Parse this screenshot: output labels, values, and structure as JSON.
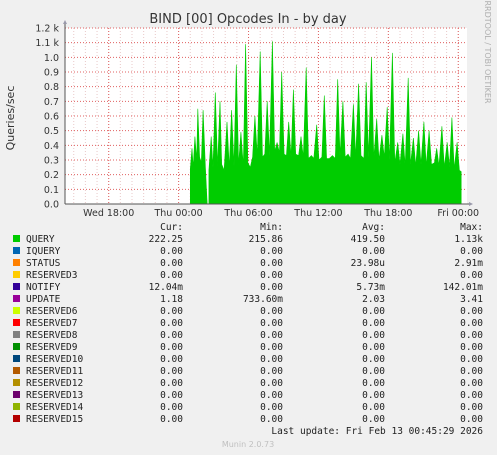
{
  "title": "BIND [00] Opcodes In - by day",
  "side_label": "RRDTOOL / TOBI OETIKER",
  "footer": "Munin 2.0.73",
  "last_update": "Last update: Fri Feb 13 00:45:29 2026",
  "table_headers": {
    "cur": "Cur:",
    "min": "Min:",
    "avg": "Avg:",
    "max": "Max:"
  },
  "chart_data": {
    "type": "area",
    "title": "BIND [00] Opcodes In - by day",
    "ylabel": "Queries/sec",
    "xlabel": "",
    "grid": true,
    "ylim": [
      0,
      1200
    ],
    "y_ticks": [
      {
        "v": 0,
        "label": "0.0"
      },
      {
        "v": 100,
        "label": "0.1"
      },
      {
        "v": 200,
        "label": "0.2"
      },
      {
        "v": 300,
        "label": "0.3"
      },
      {
        "v": 400,
        "label": "0.4"
      },
      {
        "v": 500,
        "label": "0.5"
      },
      {
        "v": 600,
        "label": "0.6"
      },
      {
        "v": 700,
        "label": "0.7"
      },
      {
        "v": 800,
        "label": "0.8"
      },
      {
        "v": 900,
        "label": "0.9"
      },
      {
        "v": 1000,
        "label": "1.0"
      },
      {
        "v": 1100,
        "label": "1.1 k"
      },
      {
        "v": 1200,
        "label": "1.2 k"
      }
    ],
    "xlim": [
      -9.75,
      24.75
    ],
    "x_ticks": [
      {
        "v": -6,
        "label": "Wed 18:00"
      },
      {
        "v": 0,
        "label": "Thu 00:00"
      },
      {
        "v": 6,
        "label": "Thu 06:00"
      },
      {
        "v": 12,
        "label": "Thu 12:00"
      },
      {
        "v": 18,
        "label": "Thu 18:00"
      },
      {
        "v": 24,
        "label": "Fri 00:00"
      }
    ],
    "series": [
      {
        "name": "QUERY",
        "color": "#00cc00",
        "points": [
          [
            1.0,
            0
          ],
          [
            1.0,
            240
          ],
          [
            1.15,
            380
          ],
          [
            1.25,
            250
          ],
          [
            1.4,
            460
          ],
          [
            1.55,
            300
          ],
          [
            1.65,
            650
          ],
          [
            1.8,
            320
          ],
          [
            1.95,
            280
          ],
          [
            2.1,
            640
          ],
          [
            2.3,
            250
          ],
          [
            2.45,
            0
          ],
          [
            2.6,
            0
          ],
          [
            2.6,
            230
          ],
          [
            2.8,
            460
          ],
          [
            2.95,
            250
          ],
          [
            3.15,
            760
          ],
          [
            3.35,
            260
          ],
          [
            3.55,
            700
          ],
          [
            3.7,
            270
          ],
          [
            3.9,
            230
          ],
          [
            4.15,
            560
          ],
          [
            4.35,
            250
          ],
          [
            4.55,
            640
          ],
          [
            4.75,
            260
          ],
          [
            4.95,
            950
          ],
          [
            5.15,
            270
          ],
          [
            5.35,
            490
          ],
          [
            5.55,
            260
          ],
          [
            5.75,
            1090
          ],
          [
            5.95,
            280
          ],
          [
            6.15,
            250
          ],
          [
            6.35,
            320
          ],
          [
            6.55,
            600
          ],
          [
            6.75,
            330
          ],
          [
            7.0,
            1040
          ],
          [
            7.2,
            320
          ],
          [
            7.4,
            340
          ],
          [
            7.6,
            700
          ],
          [
            7.8,
            330
          ],
          [
            8.05,
            1110
          ],
          [
            8.25,
            360
          ],
          [
            8.45,
            420
          ],
          [
            8.65,
            350
          ],
          [
            8.85,
            900
          ],
          [
            9.05,
            340
          ],
          [
            9.25,
            330
          ],
          [
            9.45,
            560
          ],
          [
            9.65,
            320
          ],
          [
            9.85,
            780
          ],
          [
            10.05,
            340
          ],
          [
            10.3,
            330
          ],
          [
            10.5,
            460
          ],
          [
            10.7,
            320
          ],
          [
            10.95,
            930
          ],
          [
            11.15,
            310
          ],
          [
            11.4,
            330
          ],
          [
            11.6,
            310
          ],
          [
            11.85,
            540
          ],
          [
            12.05,
            300
          ],
          [
            12.3,
            320
          ],
          [
            12.5,
            740
          ],
          [
            12.7,
            310
          ],
          [
            12.95,
            310
          ],
          [
            13.2,
            330
          ],
          [
            13.45,
            310
          ],
          [
            13.65,
            850
          ],
          [
            13.85,
            330
          ],
          [
            14.1,
            700
          ],
          [
            14.3,
            320
          ],
          [
            14.55,
            340
          ],
          [
            14.75,
            310
          ],
          [
            15.0,
            680
          ],
          [
            15.2,
            320
          ],
          [
            15.45,
            820
          ],
          [
            15.65,
            330
          ],
          [
            15.9,
            310
          ],
          [
            16.1,
            830
          ],
          [
            16.3,
            320
          ],
          [
            16.55,
            1000
          ],
          [
            16.75,
            310
          ],
          [
            17.0,
            580
          ],
          [
            17.2,
            300
          ],
          [
            17.45,
            470
          ],
          [
            17.65,
            320
          ],
          [
            17.9,
            660
          ],
          [
            18.1,
            300
          ],
          [
            18.35,
            1030
          ],
          [
            18.55,
            280
          ],
          [
            18.8,
            420
          ],
          [
            19.0,
            270
          ],
          [
            19.25,
            480
          ],
          [
            19.45,
            260
          ],
          [
            19.7,
            860
          ],
          [
            19.9,
            270
          ],
          [
            20.15,
            450
          ],
          [
            20.35,
            260
          ],
          [
            20.6,
            500
          ],
          [
            20.8,
            270
          ],
          [
            21.05,
            560
          ],
          [
            21.25,
            260
          ],
          [
            21.5,
            500
          ],
          [
            21.7,
            270
          ],
          [
            21.95,
            280
          ],
          [
            22.15,
            380
          ],
          [
            22.35,
            260
          ],
          [
            22.6,
            530
          ],
          [
            22.8,
            250
          ],
          [
            23.05,
            420
          ],
          [
            23.25,
            250
          ],
          [
            23.45,
            590
          ],
          [
            23.65,
            240
          ],
          [
            23.9,
            420
          ],
          [
            24.1,
            230
          ],
          [
            24.25,
            220
          ],
          [
            24.25,
            0
          ]
        ]
      }
    ]
  },
  "legend": [
    {
      "name": "QUERY",
      "color": "#00cc00",
      "cur": "222.25",
      "min": "215.86",
      "avg": "419.50",
      "max": "1.13k"
    },
    {
      "name": "IQUERY",
      "color": "#0066b3",
      "cur": "0.00",
      "min": "0.00",
      "avg": "0.00",
      "max": "0.00"
    },
    {
      "name": "STATUS",
      "color": "#ff8000",
      "cur": "0.00",
      "min": "0.00",
      "avg": "23.98u",
      "max": "2.91m"
    },
    {
      "name": "RESERVED3",
      "color": "#ffcc00",
      "cur": "0.00",
      "min": "0.00",
      "avg": "0.00",
      "max": "0.00"
    },
    {
      "name": "NOTIFY",
      "color": "#330099",
      "cur": "12.04m",
      "min": "0.00",
      "avg": "5.73m",
      "max": "142.01m"
    },
    {
      "name": "UPDATE",
      "color": "#990099",
      "cur": "1.18",
      "min": "733.60m",
      "avg": "2.03",
      "max": "3.41"
    },
    {
      "name": "RESERVED6",
      "color": "#ccff00",
      "cur": "0.00",
      "min": "0.00",
      "avg": "0.00",
      "max": "0.00"
    },
    {
      "name": "RESERVED7",
      "color": "#ff0000",
      "cur": "0.00",
      "min": "0.00",
      "avg": "0.00",
      "max": "0.00"
    },
    {
      "name": "RESERVED8",
      "color": "#808080",
      "cur": "0.00",
      "min": "0.00",
      "avg": "0.00",
      "max": "0.00"
    },
    {
      "name": "RESERVED9",
      "color": "#008f00",
      "cur": "0.00",
      "min": "0.00",
      "avg": "0.00",
      "max": "0.00"
    },
    {
      "name": "RESERVED10",
      "color": "#00487d",
      "cur": "0.00",
      "min": "0.00",
      "avg": "0.00",
      "max": "0.00"
    },
    {
      "name": "RESERVED11",
      "color": "#b35a00",
      "cur": "0.00",
      "min": "0.00",
      "avg": "0.00",
      "max": "0.00"
    },
    {
      "name": "RESERVED12",
      "color": "#b38f00",
      "cur": "0.00",
      "min": "0.00",
      "avg": "0.00",
      "max": "0.00"
    },
    {
      "name": "RESERVED13",
      "color": "#6b006b",
      "cur": "0.00",
      "min": "0.00",
      "avg": "0.00",
      "max": "0.00"
    },
    {
      "name": "RESERVED14",
      "color": "#8fb300",
      "cur": "0.00",
      "min": "0.00",
      "avg": "0.00",
      "max": "0.00"
    },
    {
      "name": "RESERVED15",
      "color": "#b30000",
      "cur": "0.00",
      "min": "0.00",
      "avg": "0.00",
      "max": "0.00"
    }
  ]
}
